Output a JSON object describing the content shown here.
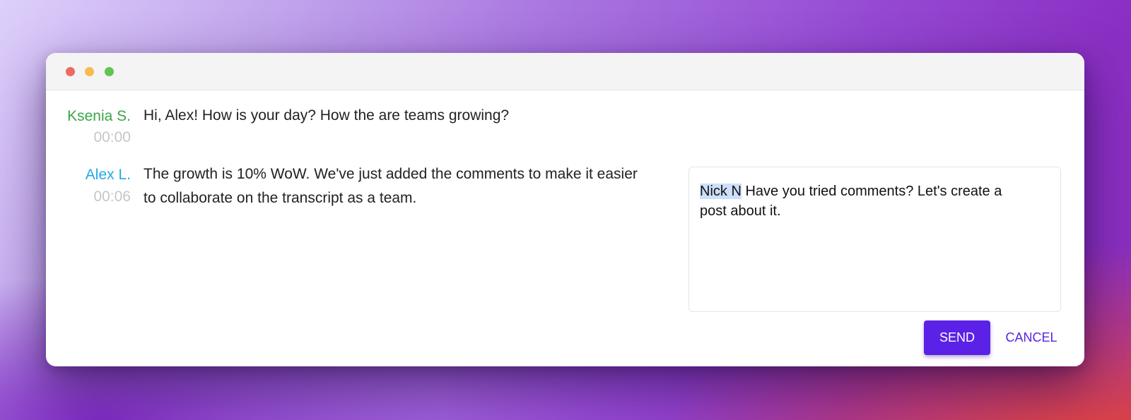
{
  "transcript": {
    "entries": [
      {
        "speaker": "Ksenia S.",
        "speaker_color": "#3aa54a",
        "time": "00:00",
        "text": "Hi, Alex! How is your day? How the are teams growing?"
      },
      {
        "speaker": "Alex L.",
        "speaker_color": "#23a8e6",
        "time": "00:06",
        "text_line1": "The growth is 10% WoW. We've just added the comments to make it easier",
        "text_line2": "to collaborate on the transcript as a team."
      }
    ]
  },
  "comment": {
    "mention": "Nick N",
    "text_line1": " Have you tried comments? Let's create a",
    "text_line2": "post about it.",
    "send_label": "SEND",
    "cancel_label": "CANCEL"
  },
  "colors": {
    "accent": "#5b21e6",
    "mention_highlight": "#cddffa"
  }
}
